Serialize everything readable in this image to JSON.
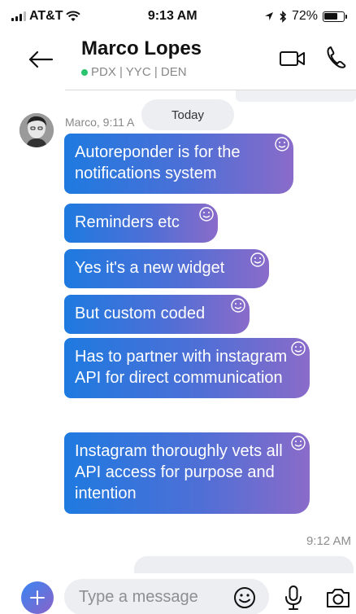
{
  "status_bar": {
    "carrier": "AT&T",
    "time": "9:13 AM",
    "battery_percent": "72%",
    "battery_level": 0.72
  },
  "header": {
    "title": "Marco Lopes",
    "subtitle": "PDX | YYC | DEN",
    "online": true,
    "online_color": "#29c46b"
  },
  "chat": {
    "date_separator": "Today",
    "sender_meta": "Marco, 9:11 A",
    "messages": [
      {
        "text": "Autoreponder is for the notifications system"
      },
      {
        "text": "Reminders etc"
      },
      {
        "text": "Yes it's a new widget"
      },
      {
        "text": "But custom coded"
      },
      {
        "text": "Has to partner with instagram API for direct communication"
      },
      {
        "text": "Instagram thoroughly vets all API access for purpose and intention"
      }
    ],
    "timestamp": "9:12 AM"
  },
  "composer": {
    "placeholder": "Type a message"
  },
  "colors": {
    "bubble_start": "#1e7ae0",
    "bubble_end": "#8a6bc9",
    "accent": "#3a86f2"
  },
  "icons": [
    "signal-icon",
    "wifi-icon",
    "location-icon",
    "bluetooth-icon",
    "battery-icon",
    "back-arrow-icon",
    "video-call-icon",
    "phone-icon",
    "reaction-icon",
    "plus-icon",
    "emoji-icon",
    "microphone-icon",
    "camera-icon"
  ]
}
